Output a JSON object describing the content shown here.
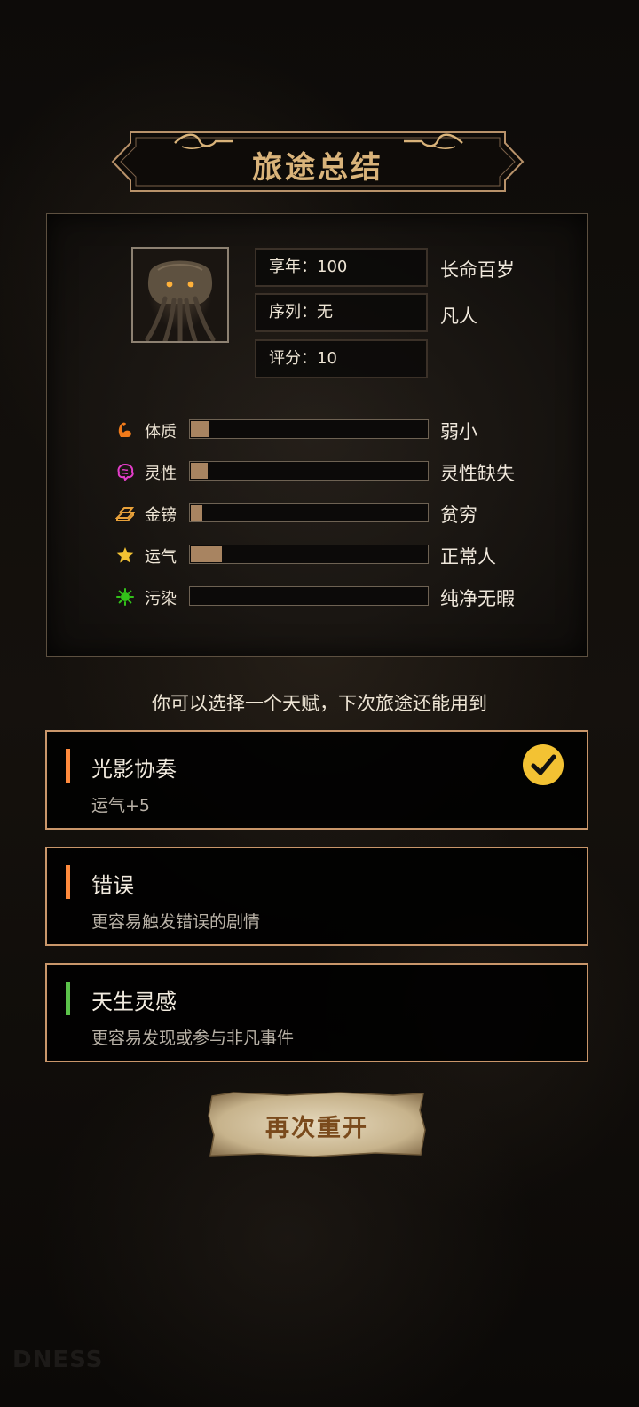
{
  "banner": {
    "title": "旅途总结"
  },
  "summary": {
    "age": {
      "label": "享年：100",
      "tag": "长命百岁"
    },
    "sequence": {
      "label": "序列：无",
      "tag": "凡人"
    },
    "score": {
      "label": "评分：10"
    }
  },
  "attributes": [
    {
      "name": "体质",
      "icon": "flexed-arm-icon",
      "level": 0.08,
      "value": "弱小",
      "icon_color": "#f07a1a"
    },
    {
      "name": "灵性",
      "icon": "brain-icon",
      "level": 0.07,
      "value": "灵性缺失",
      "icon_color": "#e23dc8"
    },
    {
      "name": "金镑",
      "icon": "gold-bars-icon",
      "level": 0.05,
      "value": "贫穷",
      "icon_color": "#e8a13a"
    },
    {
      "name": "运气",
      "icon": "star-icon",
      "level": 0.13,
      "value": "正常人",
      "icon_color": "#f3c233"
    },
    {
      "name": "污染",
      "icon": "virus-icon",
      "level": 0.0,
      "value": "纯净无暇",
      "icon_color": "#33c21a"
    }
  ],
  "hint": "你可以选择一个天赋，下次旅途还能用到",
  "talents": [
    {
      "name": "光影协奏",
      "desc": "运气+5",
      "stripe_color": "#ff8a3d",
      "selected": true
    },
    {
      "name": "错误",
      "desc": "更容易触发错误的剧情",
      "stripe_color": "#ff8a3d",
      "selected": false
    },
    {
      "name": "天生灵感",
      "desc": "更容易发现或参与非凡事件",
      "stripe_color": "#5bc24a",
      "selected": false
    }
  ],
  "restart_label": "再次重开",
  "watermark": "DNESS"
}
